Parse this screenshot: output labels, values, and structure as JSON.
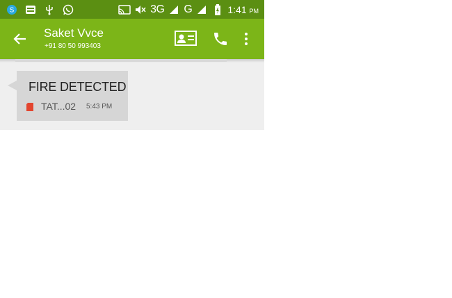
{
  "status_bar": {
    "network_type": "3G",
    "network_type_2": "G",
    "time": "1:41",
    "time_suffix": "PM",
    "icons": [
      "skype-icon",
      "notification-icon",
      "usb-icon",
      "whatsapp-icon",
      "cast-icon",
      "mute-icon",
      "signal-icon",
      "battery-icon"
    ]
  },
  "app_bar": {
    "contact_name": "Saket Vvce",
    "contact_number": "+91 80 50 993403",
    "icons": [
      "back-arrow-icon",
      "contact-card-icon",
      "phone-icon",
      "more-vert-icon"
    ]
  },
  "conversation": {
    "messages": [
      {
        "text": "FIRE DETECTED",
        "sim": "TAT...02",
        "time": "5:43 PM"
      }
    ]
  },
  "colors": {
    "status_bar": "#5b8f12",
    "app_bar": "#7cb518",
    "background": "#efefef",
    "bubble": "#d6d6d6",
    "sim_icon": "#e3452f"
  }
}
